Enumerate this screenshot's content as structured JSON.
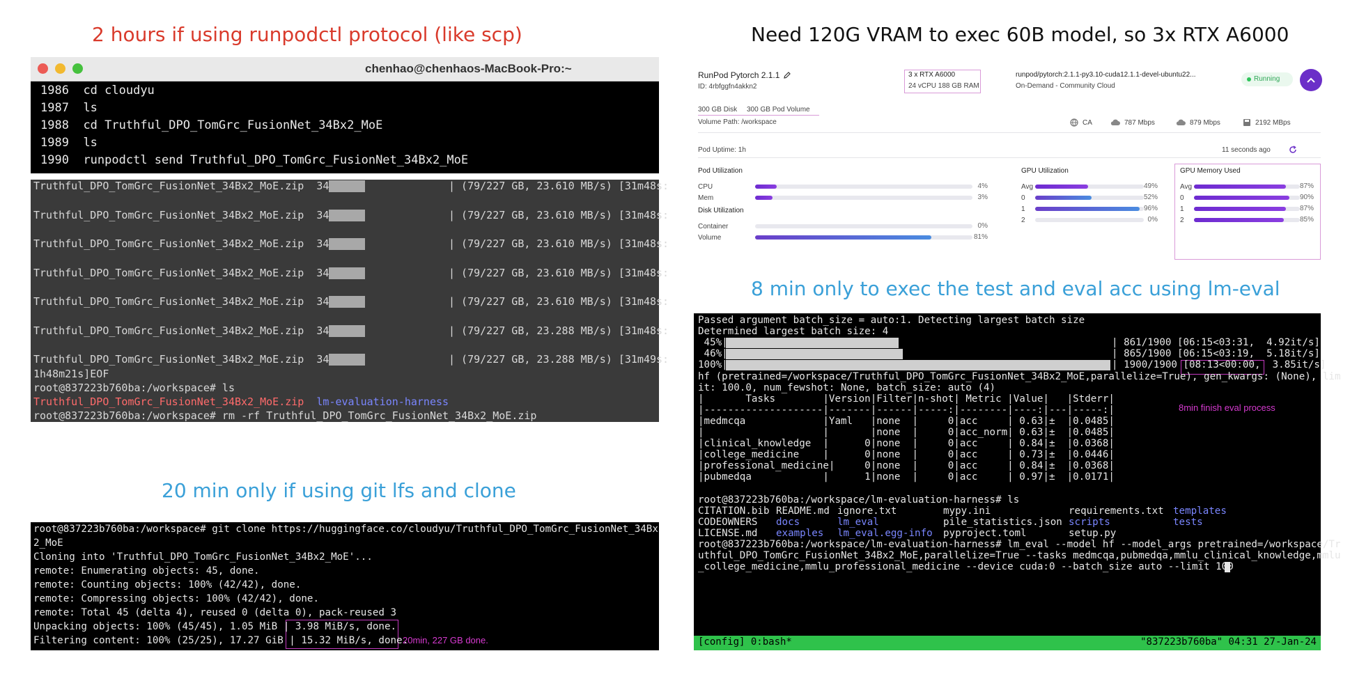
{
  "captions": {
    "runpodctl": "2 hours if using runpodctl protocol (like scp)",
    "vram": "Need 120G VRAM to exec 60B model, so 3x RTX A6000",
    "eval": "8 min only to exec the test and eval acc using lm-eval",
    "git": "20 min only if using git lfs and clone"
  },
  "mac_terminal": {
    "title": "chenhao@chenhaos-MacBook-Pro:~",
    "history": [
      {
        "num": "1986",
        "cmd": "cd cloudyu"
      },
      {
        "num": "1987",
        "cmd": "ls"
      },
      {
        "num": "1988",
        "cmd": "cd Truthful_DPO_TomGrc_FusionNet_34Bx2_MoE"
      },
      {
        "num": "1989",
        "cmd": "ls"
      },
      {
        "num": "1990",
        "cmd": "runpodctl send Truthful_DPO_TomGrc_FusionNet_34Bx2_MoE"
      }
    ]
  },
  "transfer_terminal": {
    "progress_lines": [
      {
        "file": "Truthful_DPO_TomGrc_FusionNet_34Bx2_MoE.zip",
        "pct": "34% |",
        "stats": "| (79/227 GB, 23.610 MB/s) [31m48s:"
      },
      {
        "file": "Truthful_DPO_TomGrc_FusionNet_34Bx2_MoE.zip",
        "pct": "34% |",
        "stats": "| (79/227 GB, 23.610 MB/s) [31m48s:"
      },
      {
        "file": "Truthful_DPO_TomGrc_FusionNet_34Bx2_MoE.zip",
        "pct": "34% |",
        "stats": "| (79/227 GB, 23.610 MB/s) [31m48s:"
      },
      {
        "file": "Truthful_DPO_TomGrc_FusionNet_34Bx2_MoE.zip",
        "pct": "34% |",
        "stats": "| (79/227 GB, 23.610 MB/s) [31m48s:"
      },
      {
        "file": "Truthful_DPO_TomGrc_FusionNet_34Bx2_MoE.zip",
        "pct": "34% |",
        "stats": "| (79/227 GB, 23.610 MB/s) [31m48s:"
      },
      {
        "file": "Truthful_DPO_TomGrc_FusionNet_34Bx2_MoE.zip",
        "pct": "34% |",
        "stats": "| (79/227 GB, 23.288 MB/s) [31m48s:"
      },
      {
        "file": "Truthful_DPO_TomGrc_FusionNet_34Bx2_MoE.zip",
        "pct": "34% |",
        "stats": "| (79/227 GB, 23.288 MB/s) [31m49s:"
      }
    ],
    "eof_line": "1h48m21s]EOF",
    "prompt1": "root@837223b760ba:/workspace# ls",
    "ls_zip": "Truthful_DPO_TomGrc_FusionNet_34Bx2_MoE.zip",
    "ls_dir": "lm-evaluation-harness",
    "prompt2": "root@837223b760ba:/workspace# rm -rf Truthful_DPO_TomGrc_FusionNet_34Bx2_MoE.zip"
  },
  "runpod": {
    "name": "RunPod Pytorch 2.1.1",
    "id": "ID: 4rbfggfn4akkn2",
    "gpu": "3 x RTX A6000",
    "cpu_ram": "24 vCPU 188 GB RAM",
    "image": "runpod/pytorch:2.1.1-py3.10-cuda12.1.1-devel-ubuntu22...",
    "cloud": "On-Demand - Community Cloud",
    "status": "Running",
    "disk": "300 GB Disk",
    "volume": "300 GB Pod Volume",
    "volume_path": "Volume Path: /workspace",
    "region": "CA",
    "down": "787 Mbps",
    "up": "879 Mbps",
    "disk_speed": "2192 MBps",
    "uptime": "Pod Uptime: 1h",
    "updated": "11 seconds ago",
    "pod_util_title": "Pod Utilization",
    "cpu_label": "CPU",
    "cpu_pct": 4,
    "cpu_text": "4%",
    "mem_label": "Mem",
    "mem_pct": 3,
    "mem_text": "3%",
    "disk_util_title": "Disk Utilization",
    "container_label": "Container",
    "container_pct": 0,
    "container_text": "0%",
    "volume_label": "Volume",
    "volume_pct": 81,
    "volume_text": "81%",
    "gpu_util_title": "GPU Utilization",
    "gpu_util": [
      {
        "label": "Avg",
        "pct": 49,
        "text": "49%"
      },
      {
        "label": "0",
        "pct": 52,
        "text": "52%"
      },
      {
        "label": "1",
        "pct": 96,
        "text": "96%"
      },
      {
        "label": "2",
        "pct": 0,
        "text": "0%"
      }
    ],
    "gpu_mem_title": "GPU Memory Used",
    "gpu_mem": [
      {
        "label": "Avg",
        "pct": 87,
        "text": "87%"
      },
      {
        "label": "0",
        "pct": 90,
        "text": "90%"
      },
      {
        "label": "1",
        "pct": 87,
        "text": "87%"
      },
      {
        "label": "2",
        "pct": 85,
        "text": "85%"
      }
    ]
  },
  "eval_terminal": {
    "lines": [
      "Passed argument batch_size = auto:1. Detecting largest batch size",
      "Determined largest batch size: 4"
    ],
    "progress": [
      {
        "pct": " 45%|",
        "stats": "| 861/1900 [06:15<03:31,  4.92it/s]",
        "fill": 0.45
      },
      {
        "pct": " 46%|",
        "stats": "| 865/1900 [06:15<03:19,  5.18it/s]",
        "fill": 0.46
      },
      {
        "pct": "100%|",
        "stats": "| 1900/1900 [08:13<00:00,  3.85it/s]",
        "fill": 1.0
      }
    ],
    "hf_line1": "hf (pretrained=/workspace/Truthful_DPO_TomGrc_FusionNet_34Bx2_MoE,parallelize=True), gen_kwargs: (None), lim",
    "hf_line2": "it: 100.0, num_fewshot: None, batch_size: auto (4)",
    "note": "8min finish eval process",
    "table": [
      "|       Tasks        |Version|Filter|n-shot| Metric |Value|   |Stderr|",
      "|--------------------|-------|------|-----:|--------|----:|---|-----:|",
      "|medmcqa             |Yaml   |none  |     0|acc     | 0.63|±  |0.0485|",
      "|                    |       |none  |     0|acc_norm| 0.63|±  |0.0485|",
      "|clinical_knowledge  |      0|none  |     0|acc     | 0.84|±  |0.0368|",
      "|college_medicine    |      0|none  |     0|acc     | 0.73|±  |0.0446|",
      "|professional_medicine|     0|none  |     0|acc     | 0.84|±  |0.0368|",
      "|pubmedqa            |      1|none  |     0|acc     | 0.97|±  |0.0171|"
    ],
    "prompt_ls": "root@837223b760ba:/workspace/lm-evaluation-harness# ls",
    "ls_rows": [
      [
        {
          "t": "CITATION.bib",
          "c": ""
        },
        {
          "t": "README.md",
          "c": ""
        },
        {
          "t": "ignore.txt",
          "c": ""
        },
        {
          "t": "mypy.ini",
          "c": ""
        },
        {
          "t": "requirements.txt",
          "c": ""
        },
        {
          "t": "templates",
          "c": "blue"
        }
      ],
      [
        {
          "t": "CODEOWNERS",
          "c": ""
        },
        {
          "t": "docs",
          "c": "blue"
        },
        {
          "t": "lm_eval",
          "c": "blue"
        },
        {
          "t": "pile_statistics.json",
          "c": ""
        },
        {
          "t": "scripts",
          "c": "blue"
        },
        {
          "t": "tests",
          "c": "blue"
        }
      ],
      [
        {
          "t": "LICENSE.md",
          "c": ""
        },
        {
          "t": "examples",
          "c": "blue"
        },
        {
          "t": "lm_eval.egg-info",
          "c": "blue"
        },
        {
          "t": "pyproject.toml",
          "c": ""
        },
        {
          "t": "setup.py",
          "c": ""
        },
        {
          "t": "",
          "c": ""
        }
      ]
    ],
    "cmd1": "root@837223b760ba:/workspace/lm-evaluation-harness# lm_eval --model hf --model_args pretrained=/workspace/Tr",
    "cmd2": "uthful_DPO_TomGrc_FusionNet_34Bx2_MoE,parallelize=True --tasks medmcqa,pubmedqa,mmlu_clinical_knowledge,mmlu",
    "cmd3": "_college_medicine,mmlu_professional_medicine --device cuda:0 --batch_size auto --limit 100",
    "status_left": "[config] 0:bash*",
    "status_right": "\"837223b760ba\" 04:31 27-Jan-24"
  },
  "git_terminal": {
    "lines": [
      "root@837223b760ba:/workspace# git clone https://huggingface.co/cloudyu/Truthful_DPO_TomGrc_FusionNet_34Bx",
      "2_MoE",
      "Cloning into 'Truthful_DPO_TomGrc_FusionNet_34Bx2_MoE'...",
      "remote: Enumerating objects: 45, done.",
      "remote: Counting objects: 100% (42/42), done.",
      "remote: Compressing objects: 100% (42/42), done.",
      "remote: Total 45 (delta 4), reused 0 (delta 0), pack-reused 3",
      "Unpacking objects: 100% (45/45), 1.05 MiB | 3.98 MiB/s, done.",
      "Filtering content: 100% (25/25), 17.27 GiB | 15.32 MiB/s, done."
    ],
    "note": "20min, 227 GB done."
  },
  "colors": {
    "caption_red": "#d93a2b",
    "caption_blue": "#3aa0d8",
    "tmux_green": "#2fc24b",
    "note_magenta": "#d63ad0",
    "running_green": "#2ec45a"
  }
}
